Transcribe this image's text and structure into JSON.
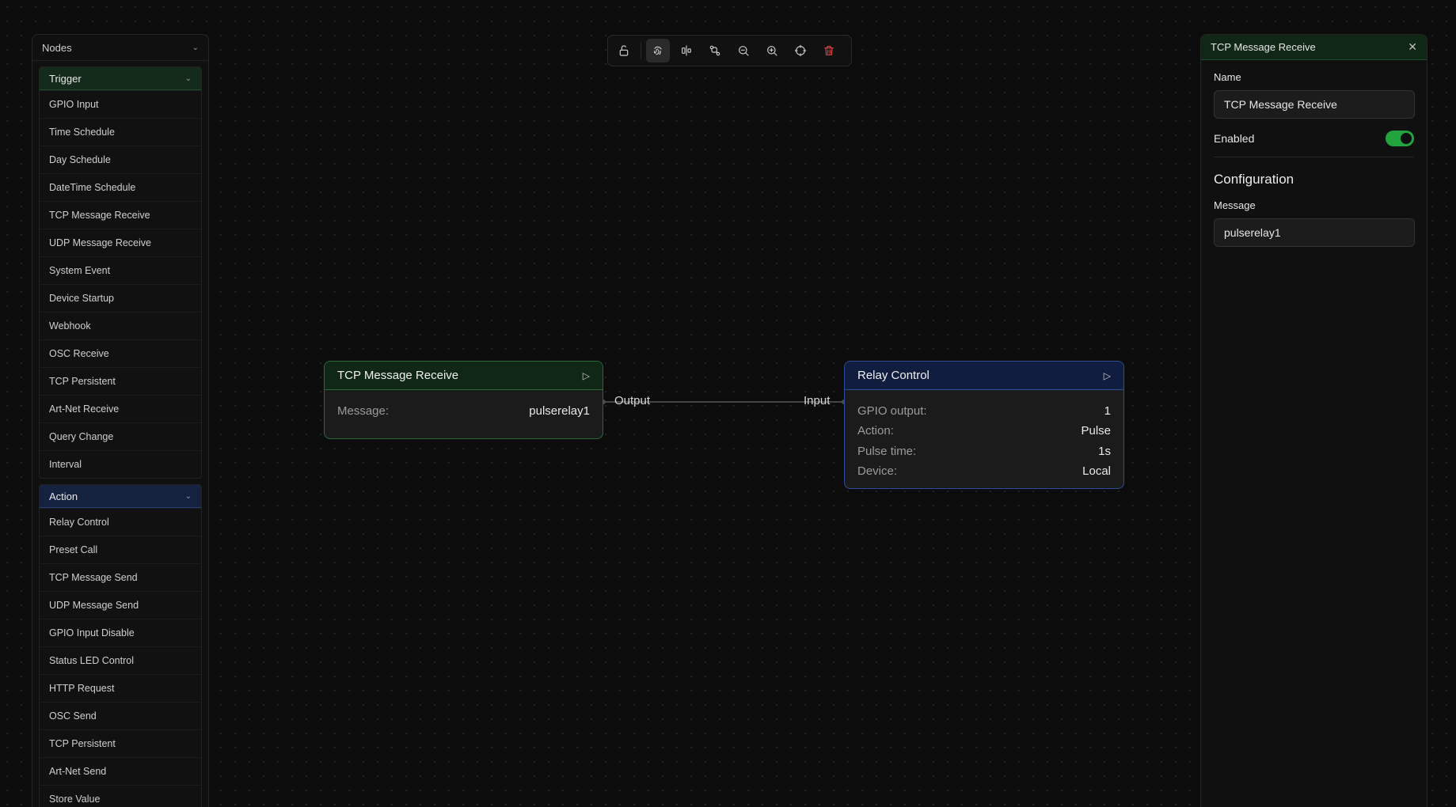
{
  "sidebar": {
    "title": "Nodes",
    "trigger_group": {
      "label": "Trigger",
      "items": [
        "GPIO Input",
        "Time Schedule",
        "Day Schedule",
        "DateTime Schedule",
        "TCP Message Receive",
        "UDP Message Receive",
        "System Event",
        "Device Startup",
        "Webhook",
        "OSC Receive",
        "TCP Persistent",
        "Art-Net Receive",
        "Query Change",
        "Interval"
      ]
    },
    "action_group": {
      "label": "Action",
      "items": [
        "Relay Control",
        "Preset Call",
        "TCP Message Send",
        "UDP Message Send",
        "GPIO Input Disable",
        "Status LED Control",
        "HTTP Request",
        "OSC Send",
        "TCP Persistent",
        "Art-Net Send",
        "Store Value"
      ]
    }
  },
  "toolbar": {
    "icons": [
      "unlock-icon",
      "fingerprint-icon",
      "align-icon",
      "connections-icon",
      "zoom-out-icon",
      "zoom-in-icon",
      "crosshair-icon",
      "trash-icon"
    ]
  },
  "canvas": {
    "trigger_node": {
      "title": "TCP Message Receive",
      "rows": [
        {
          "key": "Message:",
          "value": "pulserelay1"
        }
      ],
      "output_label": "Output"
    },
    "action_node": {
      "title": "Relay Control",
      "input_label": "Input",
      "rows": [
        {
          "key": "GPIO output:",
          "value": "1"
        },
        {
          "key": "Action:",
          "value": "Pulse"
        },
        {
          "key": "Pulse time:",
          "value": "1s"
        },
        {
          "key": "Device:",
          "value": "Local"
        }
      ]
    }
  },
  "panel": {
    "title": "TCP Message Receive",
    "name_label": "Name",
    "name_value": "TCP Message Receive",
    "enabled_label": "Enabled",
    "enabled": true,
    "section_title": "Configuration",
    "message_label": "Message",
    "message_value": "pulserelay1"
  },
  "colors": {
    "trigger_accent": "#2c6a3c",
    "action_accent": "#2d4f97",
    "toggle_on": "#22a33d",
    "danger": "#e04848"
  }
}
